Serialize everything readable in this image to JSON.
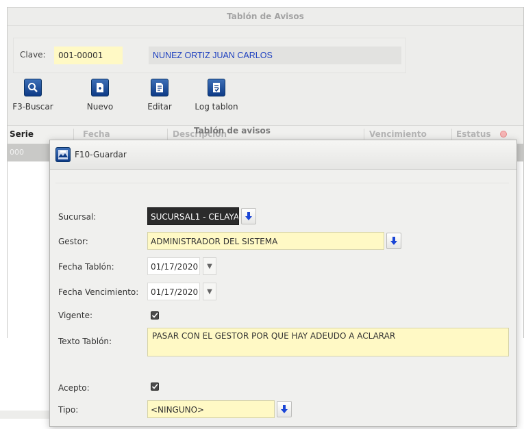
{
  "window": {
    "title": "Tablón de Avisos"
  },
  "clave": {
    "label": "Clave:",
    "value": "001-00001",
    "name": "NUNEZ ORTIZ JUAN CARLOS"
  },
  "toolbar": [
    {
      "label": "F3-Buscar",
      "icon": "search-icon"
    },
    {
      "label": "Nuevo",
      "icon": "new-document-icon"
    },
    {
      "label": "Editar",
      "icon": "edit-document-icon"
    },
    {
      "label": "Log tablon",
      "icon": "log-icon"
    }
  ],
  "grid": {
    "columns": [
      "Serie",
      "Fecha",
      "Descripción",
      "Vencimiento",
      "Estatus"
    ],
    "rows": [
      {
        "serie": "000"
      }
    ]
  },
  "dialog": {
    "title": "Tablón de avisos",
    "save_label": "F10-Guardar",
    "fields": {
      "sucursal": {
        "label": "Sucursal:",
        "value": "SUCURSAL1 - CELAYA"
      },
      "gestor": {
        "label": "Gestor:",
        "value": "ADMINISTRADOR DEL SISTEMA"
      },
      "fecha_tablon": {
        "label": "Fecha Tablón:",
        "value": "01/17/2020"
      },
      "fecha_vencimiento": {
        "label": "Fecha Vencimiento:",
        "value": "01/17/2020"
      },
      "vigente": {
        "label": "Vigente:",
        "checked": true
      },
      "texto_tablon": {
        "label": "Texto Tablón:",
        "value": "PASAR CON EL GESTOR POR QUE HAY ADEUDO A ACLARAR"
      },
      "acepto": {
        "label": "Acepto:",
        "checked": true
      },
      "tipo": {
        "label": "Tipo:",
        "value": "<NINGUNO>"
      }
    }
  },
  "colors": {
    "accent_blue": "#1c3fbf",
    "field_yellow": "#fff9c5",
    "selected_row": "#c9c9c7"
  }
}
